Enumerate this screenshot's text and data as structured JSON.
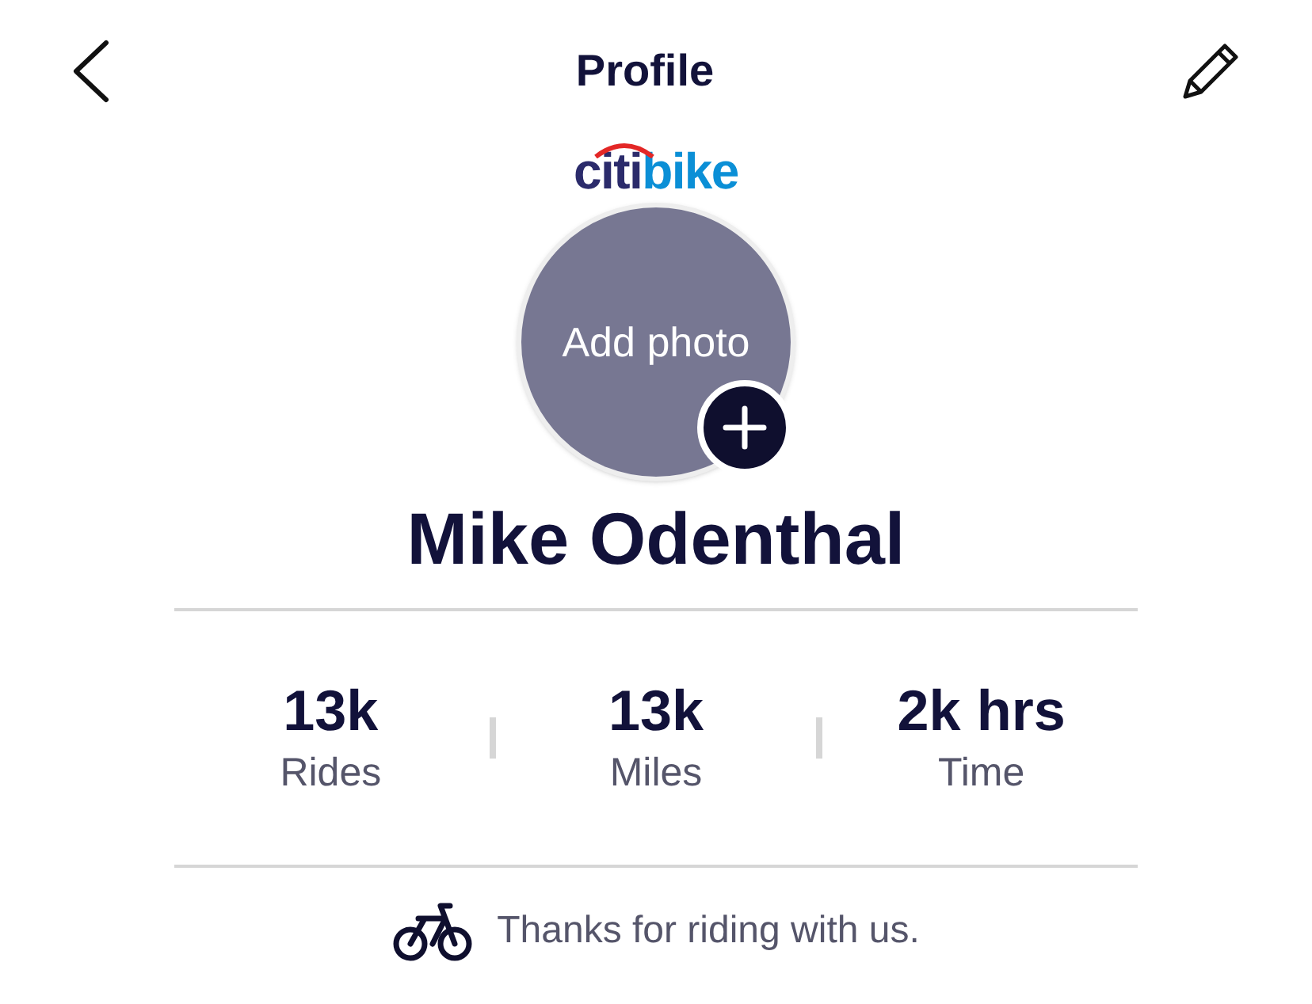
{
  "header": {
    "title": "Profile"
  },
  "logo": {
    "parts": [
      "citi",
      "bike"
    ]
  },
  "avatar": {
    "label": "Add photo"
  },
  "name": "Mike Odenthal",
  "stats": [
    {
      "value": "13k",
      "label": "Rides"
    },
    {
      "value": "13k",
      "label": "Miles"
    },
    {
      "value": "2k hrs",
      "label": "Time"
    }
  ],
  "footer": {
    "message": "Thanks for riding with us."
  }
}
